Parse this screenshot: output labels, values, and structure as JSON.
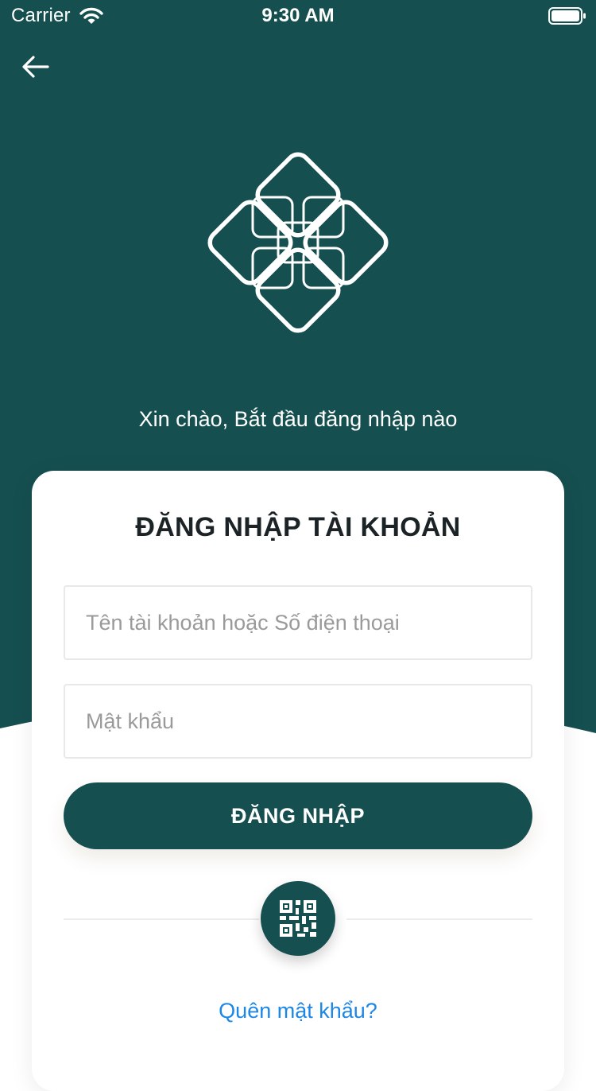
{
  "status_bar": {
    "carrier": "Carrier",
    "time": "9:30 AM",
    "wifi_icon": "wifi-icon",
    "battery_icon": "battery-icon"
  },
  "header": {
    "back_icon": "arrow-left-icon",
    "logo_icon": "interlocking-diamond-logo-icon",
    "greeting": "Xin chào, Bắt đầu đăng nhập nào"
  },
  "login_card": {
    "title": "ĐĂNG NHẬP TÀI KHOẢN",
    "username_field": {
      "value": "",
      "placeholder": "Tên tài khoản hoặc Số điện thoại"
    },
    "password_field": {
      "value": "",
      "placeholder": "Mật khẩu"
    },
    "login_button_label": "ĐĂNG NHẬP",
    "qr_icon": "qr-code-icon",
    "forgot_password_label": "Quên mật khẩu?"
  },
  "colors": {
    "primary": "#164f50",
    "link": "#1c87e6",
    "title_text": "#1c2326",
    "placeholder": "#9a9a9a",
    "background": "#ffffff"
  }
}
